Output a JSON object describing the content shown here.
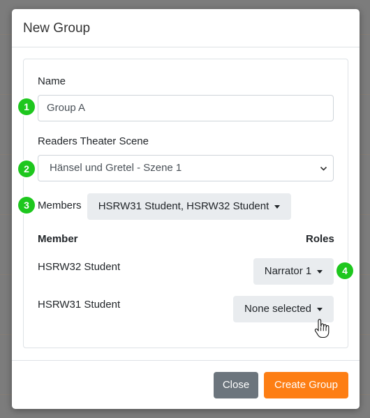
{
  "modal": {
    "title": "New Group"
  },
  "form": {
    "name_label": "Name",
    "name_value": "Group A",
    "scene_label": "Readers Theater Scene",
    "scene_value": "Hänsel und Gretel - Szene 1",
    "members_label": "Members",
    "members_value": "HSRW31 Student, HSRW32 Student"
  },
  "table": {
    "headers": {
      "member": "Member",
      "roles": "Roles"
    },
    "rows": [
      {
        "member": "HSRW32 Student",
        "role": "Narrator 1"
      },
      {
        "member": "HSRW31 Student",
        "role": "None selected"
      }
    ]
  },
  "badges": [
    "1",
    "2",
    "3",
    "4"
  ],
  "footer": {
    "close_label": "Close",
    "create_label": "Create Group"
  },
  "colors": {
    "badge": "#1ec71e",
    "primary": "#fd7e14",
    "secondary": "#6c757d"
  },
  "icons": {
    "select_chevron": "chevron-down-icon",
    "cursor": "hand-pointer-icon"
  }
}
